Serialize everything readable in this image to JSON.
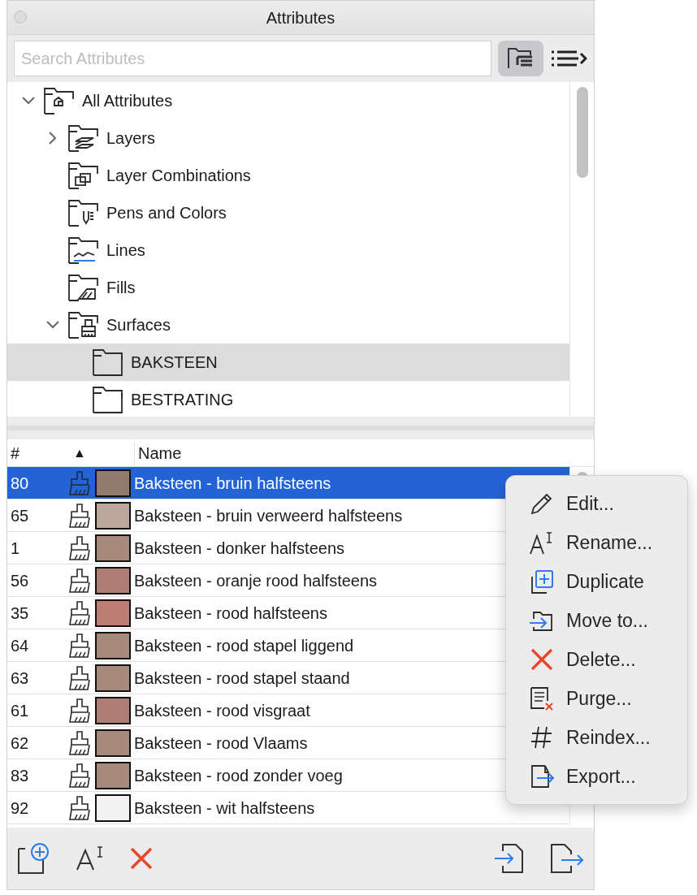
{
  "window": {
    "title": "Attributes"
  },
  "search": {
    "placeholder": "Search Attributes"
  },
  "tree": [
    {
      "label": "All Attributes",
      "kind": "all",
      "expanded": true,
      "selected": false,
      "children": [
        {
          "label": "Layers",
          "kind": "layers",
          "expanded": false,
          "selected": false
        },
        {
          "label": "Layer Combinations",
          "kind": "combos",
          "selected": false
        },
        {
          "label": "Pens and Colors",
          "kind": "pens",
          "selected": false
        },
        {
          "label": "Lines",
          "kind": "lines",
          "selected": false
        },
        {
          "label": "Fills",
          "kind": "fills",
          "selected": false
        },
        {
          "label": "Surfaces",
          "kind": "surfaces",
          "expanded": true,
          "selected": false,
          "children": [
            {
              "label": "BAKSTEEN",
              "kind": "folder",
              "selected": true
            },
            {
              "label": "BESTRATING",
              "kind": "folder",
              "selected": false
            }
          ]
        }
      ]
    }
  ],
  "table": {
    "header": {
      "number": "#",
      "sort_indicator": "▲",
      "name": "Name"
    },
    "rows": [
      {
        "number": "80",
        "name": "Baksteen - bruin halfsteens",
        "color": "#927b6c",
        "selected": true
      },
      {
        "number": "65",
        "name": "Baksteen - bruin verweerd halfsteens",
        "color": "#bca79f",
        "selected": false
      },
      {
        "number": "1",
        "name": "Baksteen - donker halfsteens",
        "color": "#a88a7c",
        "selected": false
      },
      {
        "number": "56",
        "name": "Baksteen - oranje rood halfsteens",
        "color": "#b07d74",
        "selected": false
      },
      {
        "number": "35",
        "name": "Baksteen - rood halfsteens",
        "color": "#be7c74",
        "selected": false
      },
      {
        "number": "64",
        "name": "Baksteen - rood stapel liggend",
        "color": "#a88a7c",
        "selected": false
      },
      {
        "number": "63",
        "name": "Baksteen - rood stapel staand",
        "color": "#a88a7c",
        "selected": false
      },
      {
        "number": "61",
        "name": "Baksteen - rood visgraat",
        "color": "#b07d74",
        "selected": false
      },
      {
        "number": "62",
        "name": "Baksteen - rood Vlaams",
        "color": "#a88a7c",
        "selected": false
      },
      {
        "number": "83",
        "name": "Baksteen - rood zonder voeg",
        "color": "#a88a7c",
        "selected": false
      },
      {
        "number": "92",
        "name": "Baksteen - wit halfsteens",
        "color": "#f2f2f2",
        "selected": false
      }
    ]
  },
  "context_menu": [
    {
      "label": "Edit...",
      "kind": "edit"
    },
    {
      "label": "Rename...",
      "kind": "rename"
    },
    {
      "label": "Duplicate",
      "kind": "duplicate"
    },
    {
      "label": "Move to...",
      "kind": "move"
    },
    {
      "label": "Delete...",
      "kind": "delete"
    },
    {
      "label": "Purge...",
      "kind": "purge"
    },
    {
      "label": "Reindex...",
      "kind": "reindex"
    },
    {
      "label": "Export...",
      "kind": "export"
    }
  ]
}
